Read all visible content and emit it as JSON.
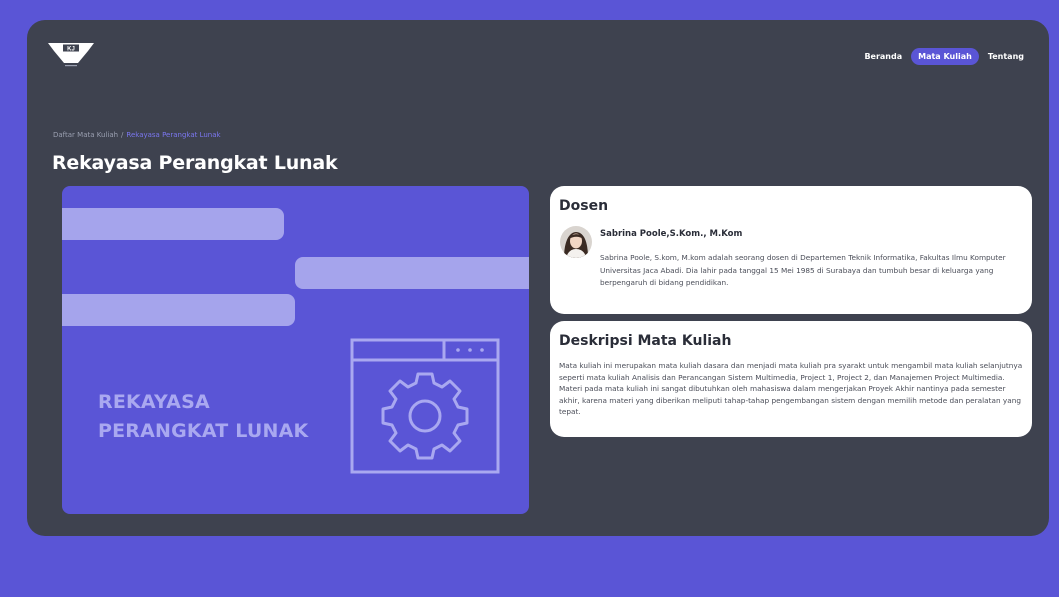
{
  "brand": {
    "logo_text": "KJ"
  },
  "nav": {
    "items": [
      {
        "label": "Beranda"
      },
      {
        "label": "Mata Kuliah"
      },
      {
        "label": "Tentang"
      }
    ]
  },
  "breadcrumb": {
    "parent": "Daftar Mata Kuliah",
    "separator": "/",
    "current": "Rekayasa Perangkat Lunak"
  },
  "page": {
    "title": "Rekayasa Perangkat Lunak"
  },
  "hero": {
    "line1": "REKAYASA",
    "line2": "PERANGKAT LUNAK"
  },
  "dosen": {
    "heading": "Dosen",
    "name": "Sabrina Poole,S.Kom., M.Kom",
    "bio": "Sabrina Poole, S.kom, M.kom adalah seorang dosen di Departemen Teknik Informatika, Fakultas Ilmu Komputer Universitas Jaca Abadi. Dia lahir pada tanggal 15 Mei 1985 di Surabaya dan tumbuh besar di keluarga yang berpengaruh di bidang pendidikan."
  },
  "deskripsi": {
    "heading": "Deskripsi Mata Kuliah",
    "text": "Mata kuliah ini merupakan mata kuliah dasara dan menjadi mata kuliah pra syarakt untuk mengambil mata kuliah selanjutnya seperti mata kuliah Analisis dan Perancangan Sistem Multimedia, Project 1, Project 2, dan Manajemen Project Multimedia. Materi pada mata kuliah ini sangat dibutuhkan oleh mahasiswa dalam mengerjakan Proyek Akhir nantinya pada semester akhir, karena materi yang diberikan meliputi tahap-tahap pengembangan sistem dengan memilih metode dan peralatan yang tepat."
  },
  "colors": {
    "accent": "#5a55d6",
    "panel": "#3e424f",
    "bar": "#a5a4ec"
  },
  "icons": {
    "logo": "kj-logo-icon",
    "hero": "settings-window-icon"
  }
}
